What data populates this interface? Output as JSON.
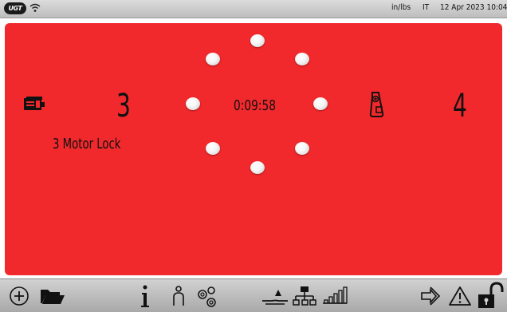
{
  "status_bar": {
    "logo_text": "UGT",
    "units": "in/lbs",
    "language": "IT",
    "datetime": "12 Apr 2023 10:04"
  },
  "main": {
    "left_value": "3",
    "left_caption": "3 Motor Lock",
    "timer": "0:09:58",
    "right_value": "4",
    "background_color": "#f2292c"
  },
  "icons": {
    "left_device": "device-icon",
    "right_device": "bottle-sensor-icon",
    "wifi": "wifi-icon"
  },
  "toolbar": {
    "items": [
      "add-icon",
      "folder-icon",
      "info-icon",
      "user-icon",
      "settings-icon",
      "level-icon",
      "network-icon",
      "signal-icon",
      "login-icon",
      "warning-icon",
      "unlock-icon"
    ]
  }
}
